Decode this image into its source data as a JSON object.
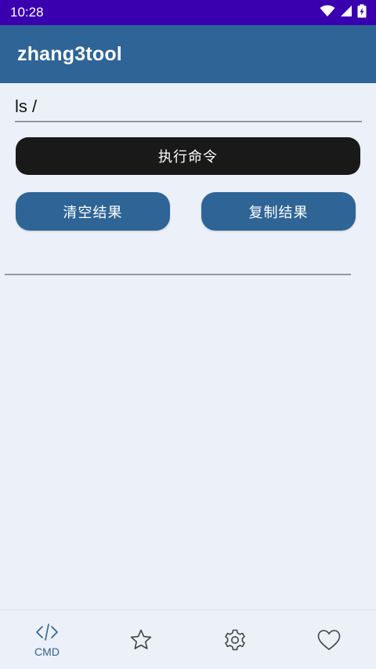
{
  "status_bar": {
    "time": "10:28"
  },
  "app_bar": {
    "title": "zhang3tool"
  },
  "command": {
    "value": "ls /",
    "placeholder": ""
  },
  "buttons": {
    "execute": "执行命令",
    "clear": "清空结果",
    "copy": "复制结果"
  },
  "result": {
    "text": ""
  },
  "bottom_nav": {
    "items": [
      {
        "icon": "code-icon",
        "label": "CMD",
        "active": true
      },
      {
        "icon": "star-icon",
        "label": "",
        "active": false
      },
      {
        "icon": "gear-icon",
        "label": "",
        "active": false
      },
      {
        "icon": "heart-icon",
        "label": "",
        "active": false
      }
    ]
  },
  "colors": {
    "status_bar": "#3a00b0",
    "app_bar": "#2e6496",
    "background": "#ecf0f9",
    "execute_button": "#191919",
    "accent": "#2e6496"
  }
}
